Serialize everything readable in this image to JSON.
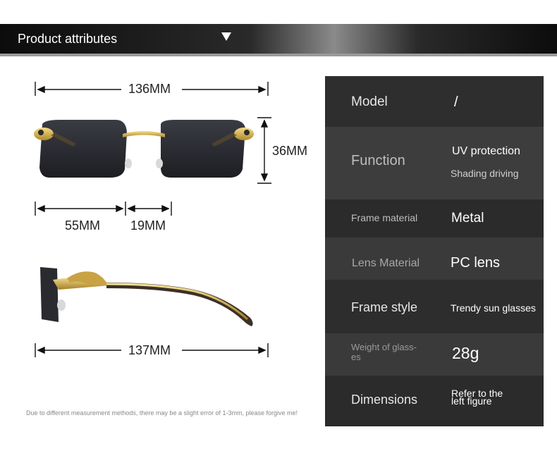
{
  "banner": {
    "title": "Product attributes",
    "arrow_icon": "triangle-down-icon"
  },
  "dimensions": {
    "width_total": "136MM",
    "height": "36MM",
    "lens_width": "55MM",
    "bridge": "19MM",
    "temple": "137MM"
  },
  "note": "Due to different measurement methods, there may be a slight error of 1-3mm, please forgive me!",
  "attributes": [
    {
      "label": "Model",
      "value": "/"
    },
    {
      "label": "Function",
      "value": "UV protection",
      "value2": "Shading driving"
    },
    {
      "label": "Frame material",
      "value": "Metal"
    },
    {
      "label": "Lens Material",
      "value": "PC lens"
    },
    {
      "label": "Frame style",
      "value": "Trendy sun glasses"
    },
    {
      "label": "Weight of glass-es",
      "value": "28g"
    },
    {
      "label": "Dimensions",
      "value": "Refer to the left figure"
    }
  ]
}
